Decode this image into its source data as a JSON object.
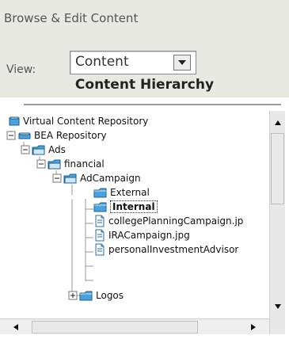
{
  "header": {
    "title": "Browse & Edit Content",
    "view_label": "View:",
    "view_select_value": "Content"
  },
  "panel": {
    "title": "Content Hierarchy"
  },
  "tree": {
    "nodes": [
      {
        "label": "Virtual Content Repository",
        "icon": "repository-icon",
        "expander": "none",
        "level": 0
      },
      {
        "label": "BEA Repository",
        "icon": "repository-icon",
        "expander": "minus",
        "level": 1
      },
      {
        "label": "Ads",
        "icon": "folder-open-icon",
        "expander": "minus",
        "level": 2
      },
      {
        "label": "financial",
        "icon": "folder-open-icon",
        "expander": "minus",
        "level": 3
      },
      {
        "label": "AdCampaign",
        "icon": "folder-open-icon",
        "expander": "minus",
        "level": 4
      },
      {
        "label": "External",
        "icon": "folder-icon",
        "expander": "none",
        "level": 5
      },
      {
        "label": "Internal",
        "icon": "folder-icon",
        "expander": "none",
        "level": 5,
        "selected": true
      },
      {
        "label": "collegePlanningCampaign.jp",
        "icon": "file-icon",
        "expander": "none",
        "level": 5
      },
      {
        "label": "IRACampaign.jpg",
        "icon": "file-icon",
        "expander": "none",
        "level": 5
      },
      {
        "label": "personalInvestmentAdvisor",
        "icon": "file-icon",
        "expander": "none",
        "level": 5
      },
      {
        "label": "Logos",
        "icon": "folder-icon",
        "expander": "plus",
        "level": 4
      }
    ]
  },
  "colors": {
    "header_bg": "#e9e9e3",
    "folder": "#4aa3df",
    "selected_border": "#333333"
  }
}
